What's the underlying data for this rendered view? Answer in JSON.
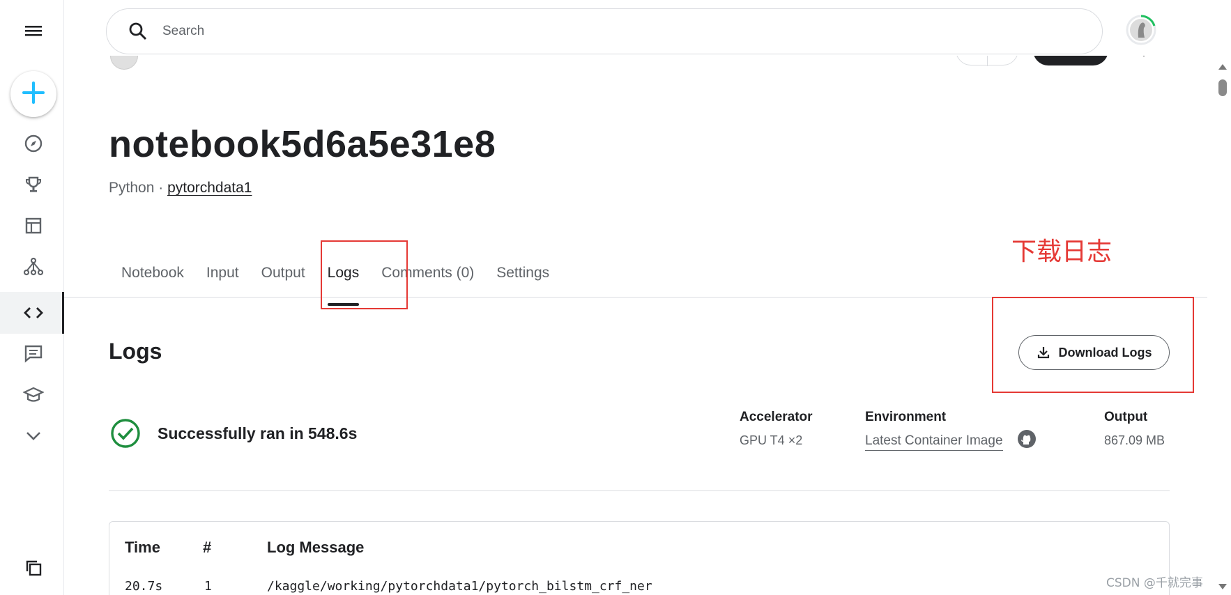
{
  "search": {
    "placeholder": "Search"
  },
  "icons": {
    "menu": "hamburger-menu-icon",
    "create": "plus-icon",
    "nav": [
      "compass-icon",
      "trophy-icon",
      "table-icon",
      "models-icon",
      "code-icon",
      "discussion-icon",
      "learn-icon",
      "chevron-down-icon"
    ],
    "bottom": "recent-pages-icon"
  },
  "header": {
    "title": "notebook5d6a5e31e8",
    "language": "Python",
    "separator": " · ",
    "dataset_link": "pytorchdata1"
  },
  "tabs": [
    "Notebook",
    "Input",
    "Output",
    "Logs",
    "Comments (0)",
    "Settings"
  ],
  "active_tab": "Logs",
  "annotation": {
    "note": "下载日志",
    "color": "#e53935"
  },
  "logs": {
    "heading": "Logs",
    "download_label": "Download Logs",
    "status_text": "Successfully ran in 548.6s",
    "accelerator_label": "Accelerator",
    "accelerator_value": "GPU T4 ×2",
    "environment_label": "Environment",
    "environment_value": "Latest Container Image",
    "output_label": "Output",
    "output_value": "867.09 MB"
  },
  "log_table": {
    "columns": [
      "Time",
      "#",
      "Log Message"
    ],
    "rows": [
      {
        "time": "20.7s",
        "num": "1",
        "message": "/kaggle/working/pytorchdata1/pytorch_bilstm_crf_ner"
      }
    ]
  },
  "watermark": "CSDN @千就完事",
  "colors": {
    "accent_blue": "#20BEFF",
    "success_green": "#1e8e3e",
    "dark": "#202124"
  }
}
